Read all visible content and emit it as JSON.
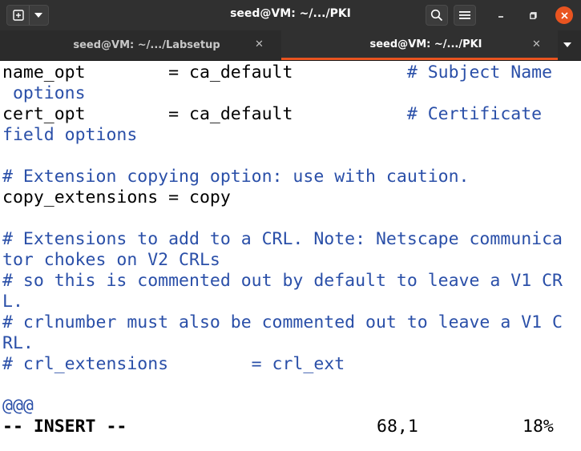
{
  "window": {
    "title": "seed@VM: ~/.../PKI"
  },
  "tabs": [
    {
      "label": "seed@VM: ~/.../Labsetup",
      "active": false
    },
    {
      "label": "seed@VM: ~/.../PKI",
      "active": true
    }
  ],
  "icons": {
    "new_tab": "new-terminal-icon",
    "dropdown": "chevron-down-icon",
    "search": "search-icon",
    "menu": "hamburger-menu-icon",
    "minimize": "minimize-icon",
    "maximize": "maximize-icon",
    "close": "close-icon"
  },
  "colors": {
    "accent": "#e95420",
    "comment": "#2a4fa8",
    "titlebar": "#303030"
  },
  "editor": {
    "lines": [
      {
        "code": "name_opt        = ca_default",
        "comment": "           # Subject Name"
      },
      {
        "code": "",
        "comment": " options"
      },
      {
        "code": "cert_opt        = ca_default",
        "comment": "           # Certificate"
      },
      {
        "code": "",
        "comment": "field options"
      },
      {
        "code": "",
        "comment": ""
      },
      {
        "code": "",
        "comment": "# Extension copying option: use with caution."
      },
      {
        "code": "copy_extensions = copy",
        "comment": ""
      },
      {
        "code": "",
        "comment": ""
      },
      {
        "code": "",
        "comment": "# Extensions to add to a CRL. Note: Netscape communica"
      },
      {
        "code": "",
        "comment": "tor chokes on V2 CRLs"
      },
      {
        "code": "",
        "comment": "# so this is commented out by default to leave a V1 CR"
      },
      {
        "code": "",
        "comment": "L."
      },
      {
        "code": "",
        "comment": "# crlnumber must also be commented out to leave a V1 C"
      },
      {
        "code": "",
        "comment": "RL."
      },
      {
        "code": "",
        "comment": "# crl_extensions        = crl_ext"
      },
      {
        "code": "",
        "comment": ""
      },
      {
        "code": "",
        "comment": "@@@"
      }
    ],
    "status": {
      "mode": "-- INSERT --",
      "position": "68,1",
      "percent": "18%"
    }
  }
}
